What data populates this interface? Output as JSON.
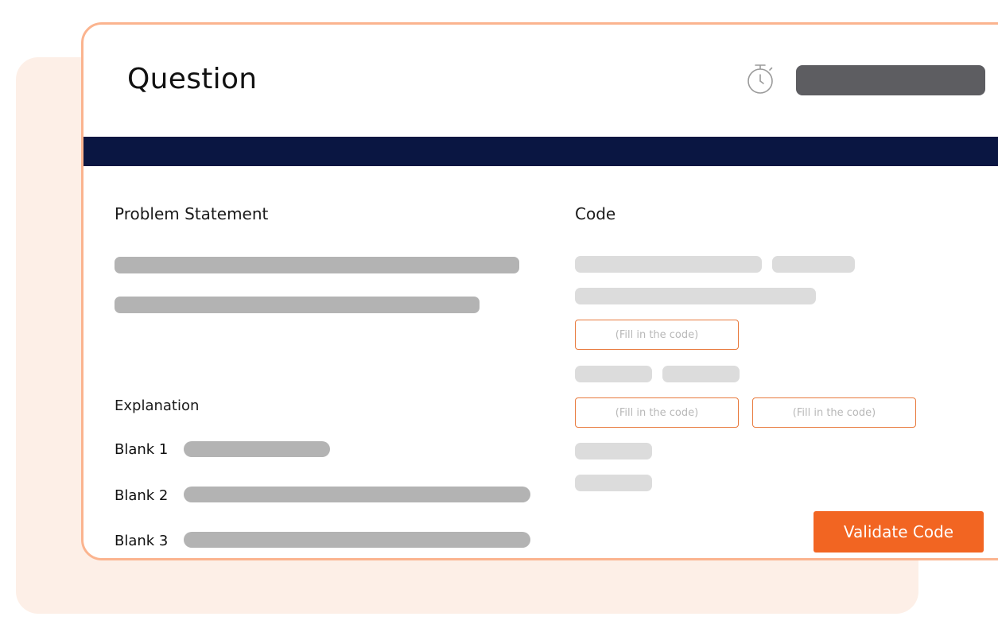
{
  "question": {
    "title": "Question"
  },
  "timer": {
    "icon": "stopwatch-icon"
  },
  "problem": {
    "heading": "Problem Statement"
  },
  "code": {
    "heading": "Code",
    "fill_placeholder_1": "(Fill in the code)",
    "fill_placeholder_2": "(Fill in the code)",
    "fill_placeholder_3": "(Fill in the code)"
  },
  "explanation": {
    "heading": "Explanation",
    "blanks": [
      {
        "label": "Blank 1"
      },
      {
        "label": "Blank 2"
      },
      {
        "label": "Blank 3"
      }
    ]
  },
  "actions": {
    "validate_label": "Validate Code"
  },
  "colors": {
    "accent": "#f26522",
    "header_band": "#0a1642",
    "card_border": "#fbb48f",
    "back_panel": "#fdefe7"
  }
}
